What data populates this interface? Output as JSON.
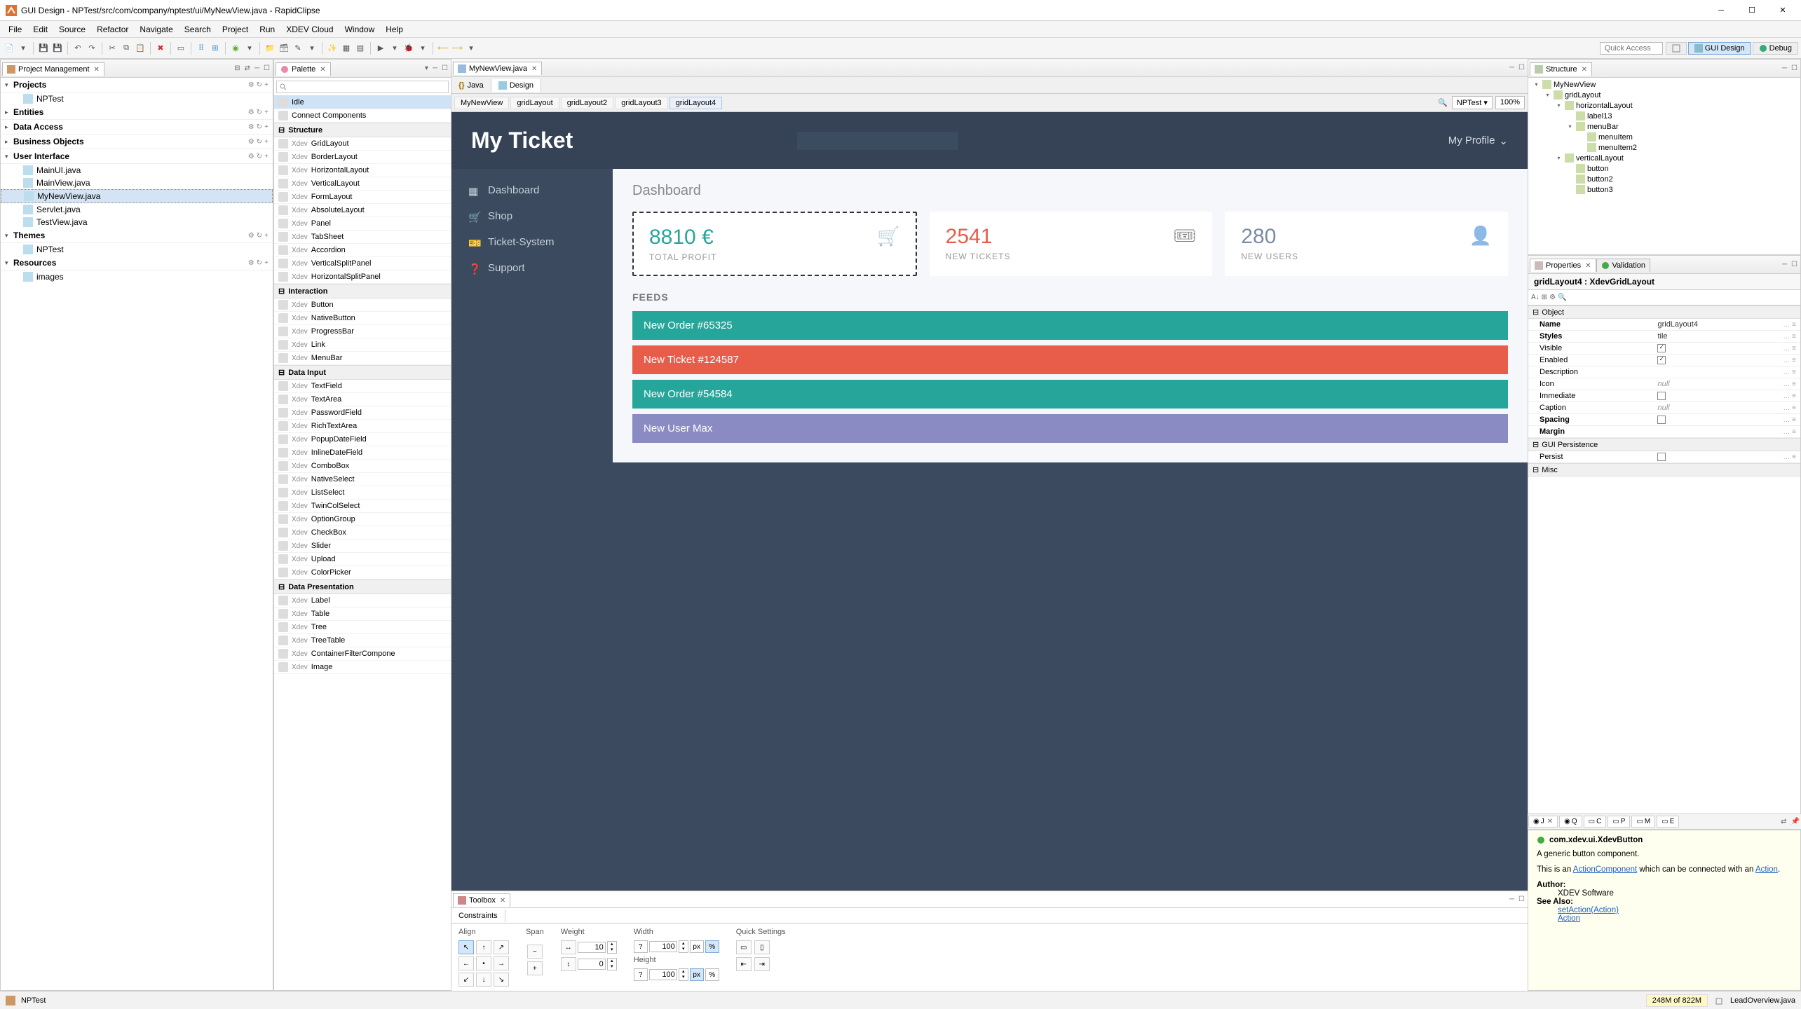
{
  "window": {
    "title": "GUI Design - NPTest/src/com/company/nptest/ui/MyNewView.java - RapidClipse"
  },
  "menus": [
    "File",
    "Edit",
    "Source",
    "Refactor",
    "Navigate",
    "Search",
    "Project",
    "Run",
    "XDEV Cloud",
    "Window",
    "Help"
  ],
  "toolbar_right": {
    "quick_access": "Quick Access",
    "perspectives": {
      "gui_design": "GUI Design",
      "debug": "Debug"
    }
  },
  "pm": {
    "tab": "Project Management",
    "sections": {
      "projects": {
        "title": "Projects",
        "items": [
          "NPTest"
        ]
      },
      "entities": {
        "title": "Entities"
      },
      "data_access": {
        "title": "Data Access"
      },
      "business_objects": {
        "title": "Business Objects"
      },
      "user_interface": {
        "title": "User Interface",
        "items": [
          "MainUI.java",
          "MainView.java",
          "MyNewView.java",
          "Servlet.java",
          "TestView.java"
        ],
        "selected": "MyNewView.java"
      },
      "themes": {
        "title": "Themes",
        "items": [
          "NPTest"
        ]
      },
      "resources": {
        "title": "Resources",
        "items": [
          "images"
        ]
      }
    }
  },
  "palette": {
    "tab": "Palette",
    "search_placeholder": "",
    "groups": [
      {
        "type": "item",
        "label": "Idle",
        "selected": true
      },
      {
        "type": "item",
        "label": "Connect Components"
      },
      {
        "type": "group",
        "label": "Structure"
      },
      {
        "type": "xitem",
        "label": "GridLayout"
      },
      {
        "type": "xitem",
        "label": "BorderLayout"
      },
      {
        "type": "xitem",
        "label": "HorizontalLayout"
      },
      {
        "type": "xitem",
        "label": "VerticalLayout"
      },
      {
        "type": "xitem",
        "label": "FormLayout"
      },
      {
        "type": "xitem",
        "label": "AbsoluteLayout"
      },
      {
        "type": "xitem",
        "label": "Panel"
      },
      {
        "type": "xitem",
        "label": "TabSheet"
      },
      {
        "type": "xitem",
        "label": "Accordion"
      },
      {
        "type": "xitem",
        "label": "VerticalSplitPanel"
      },
      {
        "type": "xitem",
        "label": "HorizontalSplitPanel"
      },
      {
        "type": "group",
        "label": "Interaction"
      },
      {
        "type": "xitem",
        "label": "Button"
      },
      {
        "type": "xitem",
        "label": "NativeButton"
      },
      {
        "type": "xitem",
        "label": "ProgressBar"
      },
      {
        "type": "xitem",
        "label": "Link"
      },
      {
        "type": "xitem",
        "label": "MenuBar"
      },
      {
        "type": "group",
        "label": "Data Input"
      },
      {
        "type": "xitem",
        "label": "TextField"
      },
      {
        "type": "xitem",
        "label": "TextArea"
      },
      {
        "type": "xitem",
        "label": "PasswordField"
      },
      {
        "type": "xitem",
        "label": "RichTextArea"
      },
      {
        "type": "xitem",
        "label": "PopupDateField"
      },
      {
        "type": "xitem",
        "label": "InlineDateField"
      },
      {
        "type": "xitem",
        "label": "ComboBox"
      },
      {
        "type": "xitem",
        "label": "NativeSelect"
      },
      {
        "type": "xitem",
        "label": "ListSelect"
      },
      {
        "type": "xitem",
        "label": "TwinColSelect"
      },
      {
        "type": "xitem",
        "label": "OptionGroup"
      },
      {
        "type": "xitem",
        "label": "CheckBox"
      },
      {
        "type": "xitem",
        "label": "Slider"
      },
      {
        "type": "xitem",
        "label": "Upload"
      },
      {
        "type": "xitem",
        "label": "ColorPicker"
      },
      {
        "type": "group",
        "label": "Data Presentation"
      },
      {
        "type": "xitem",
        "label": "Label"
      },
      {
        "type": "xitem",
        "label": "Table"
      },
      {
        "type": "xitem",
        "label": "Tree"
      },
      {
        "type": "xitem",
        "label": "TreeTable"
      },
      {
        "type": "xitem",
        "label": "ContainerFilterCompone"
      },
      {
        "type": "xitem",
        "label": "Image"
      }
    ]
  },
  "editor": {
    "tab": "MyNewView.java",
    "subtabs": {
      "java": "Java",
      "design": "Design"
    },
    "breadcrumbs": [
      "MyNewView",
      "gridLayout",
      "gridLayout2",
      "gridLayout3",
      "gridLayout4"
    ],
    "theme": "NPTest",
    "zoom": "100%"
  },
  "designer": {
    "title": "My Ticket",
    "profile": "My Profile",
    "nav": [
      "Dashboard",
      "Shop",
      "Ticket-System",
      "Support"
    ],
    "page_heading": "Dashboard",
    "tiles": [
      {
        "value": "8810 €",
        "label": "TOTAL PROFIT",
        "color": "green",
        "selected": true
      },
      {
        "value": "2541",
        "label": "NEW TICKETS",
        "color": "red"
      },
      {
        "value": "280",
        "label": "NEW USERS",
        "color": "blue"
      }
    ],
    "feeds_heading": "FEEDS",
    "feeds": [
      {
        "text": "New Order #65325",
        "color": "teal"
      },
      {
        "text": "New Ticket #124587",
        "color": "coral"
      },
      {
        "text": "New Order #54584",
        "color": "teal"
      },
      {
        "text": "New User Max",
        "color": "purple"
      }
    ]
  },
  "toolbox": {
    "tab": "Toolbox",
    "subtab": "Constraints",
    "groups": {
      "align": "Align",
      "span": "Span",
      "weight": "Weight",
      "width": "Width",
      "height": "Height",
      "quick": "Quick Settings"
    },
    "weight_val": "10",
    "weight_val2": "0",
    "width_q": "?",
    "width_val": "100",
    "height_q": "?",
    "height_val": "100",
    "units": {
      "px": "px",
      "pct": "%"
    }
  },
  "structure": {
    "tab": "Structure",
    "tree": [
      {
        "ind": 0,
        "exp": "▾",
        "icon": "window",
        "label": "MyNewView"
      },
      {
        "ind": 1,
        "exp": "▾",
        "icon": "grid",
        "label": "gridLayout"
      },
      {
        "ind": 2,
        "exp": "▾",
        "icon": "hbox",
        "label": "horizontalLayout"
      },
      {
        "ind": 3,
        "exp": "",
        "icon": "text",
        "label": "label13"
      },
      {
        "ind": 3,
        "exp": "▾",
        "icon": "menu",
        "label": "menuBar"
      },
      {
        "ind": 4,
        "exp": "",
        "icon": "menuitem",
        "label": "menuItem"
      },
      {
        "ind": 4,
        "exp": "",
        "icon": "menuitem",
        "label": "menuItem2"
      },
      {
        "ind": 2,
        "exp": "▾",
        "icon": "vbox",
        "label": "verticalLayout"
      },
      {
        "ind": 3,
        "exp": "",
        "icon": "button",
        "label": "button"
      },
      {
        "ind": 3,
        "exp": "",
        "icon": "button",
        "label": "button2"
      },
      {
        "ind": 3,
        "exp": "",
        "icon": "button",
        "label": "button3"
      }
    ]
  },
  "properties": {
    "tab": "Properties",
    "validation_tab": "Validation",
    "heading": "gridLayout4 : XdevGridLayout",
    "groups": {
      "object": "Object",
      "gui": "GUI Persistence",
      "misc": "Misc"
    },
    "rows": [
      {
        "k": "Name",
        "v": "gridLayout4",
        "bold": true
      },
      {
        "k": "Styles",
        "v": "tile",
        "bold": true
      },
      {
        "k": "Visible",
        "v": "",
        "chk": true
      },
      {
        "k": "Enabled",
        "v": "",
        "chk": true
      },
      {
        "k": "Description",
        "v": ""
      },
      {
        "k": "Icon",
        "v": "null",
        "italic": true
      },
      {
        "k": "Immediate",
        "v": "",
        "chk": false
      },
      {
        "k": "Caption",
        "v": "null",
        "italic": true
      },
      {
        "k": "Spacing",
        "v": "",
        "chk": false,
        "bold": true
      },
      {
        "k": "Margin",
        "v": "",
        "bold": true
      }
    ],
    "gui_rows": [
      {
        "k": "Persist",
        "v": "",
        "chk": false
      }
    ]
  },
  "doc": {
    "title": "com.xdev.ui.XdevButton",
    "p1": "A generic button component.",
    "p2a": "This is an ",
    "p2link": "ActionComponent",
    "p2b": " which can be connected with an ",
    "p2link2": "Action",
    "p2c": ".",
    "author_label": "Author:",
    "author": "XDEV Software",
    "seealso_label": "See Also:",
    "seealso": [
      "setAction(Action)",
      "Action"
    ],
    "tabs": {
      "j": "J",
      "q": "Q",
      "c": "C",
      "p": "P",
      "m": "M",
      "e": "E"
    }
  },
  "status": {
    "project": "NPTest",
    "memory": "248M of 822M",
    "lead": "LeadOverview.java"
  }
}
